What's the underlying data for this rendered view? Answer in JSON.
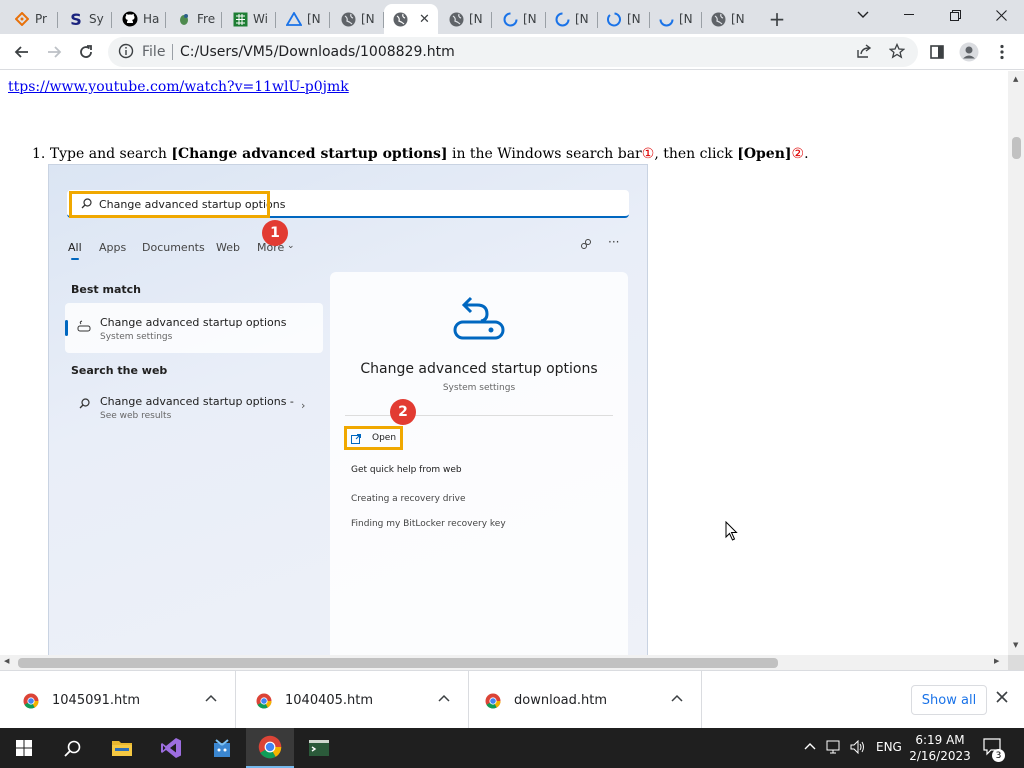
{
  "tabs": [
    {
      "label": "Pr",
      "icon": "diamond-icon",
      "color": "#e8710a"
    },
    {
      "label": "Sy",
      "icon": "s-logo-icon",
      "color": "#1a237e"
    },
    {
      "label": "Ha",
      "icon": "github-icon",
      "color": "#000000"
    },
    {
      "label": "Fre",
      "icon": "leaf-icon",
      "color": "#4e8a4e"
    },
    {
      "label": "Wi",
      "icon": "spreadsheet-icon",
      "color": "#1e7e34"
    },
    {
      "label": "[N",
      "icon": "triangle-icon",
      "color": "#1a73e8"
    },
    {
      "label": "[N",
      "icon": "globe-icon",
      "color": "#5f6368"
    },
    {
      "label": "",
      "icon": "globe-icon",
      "color": "#5f6368",
      "active": true
    },
    {
      "label": "[N",
      "icon": "globe-icon",
      "color": "#5f6368"
    },
    {
      "label": "[N",
      "icon": "loading-icon",
      "color": "#1a73e8"
    },
    {
      "label": "[N",
      "icon": "loading-icon",
      "color": "#1a73e8"
    },
    {
      "label": "[N",
      "icon": "loading-icon",
      "color": "#1a73e8"
    },
    {
      "label": "[N",
      "icon": "loading-icon",
      "color": "#1a73e8"
    },
    {
      "label": "[N",
      "icon": "globe-icon",
      "color": "#5f6368"
    }
  ],
  "toolbar": {
    "file_label": "File",
    "url": "C:/Users/VM5/Downloads/1008829.htm"
  },
  "page": {
    "link_text": "ttps://www.youtube.com/watch?v=11wlU-p0jmk",
    "step": {
      "number": "1.",
      "text_a": "Type and search ",
      "bold_a": "[Change advanced startup options]",
      "text_b": " in the Windows search bar",
      "circ_1": "①",
      "text_c": ", then click ",
      "bold_b": "[Open]",
      "circ_2": "②",
      "text_d": "."
    },
    "screenshot": {
      "search_text": "Change advanced startup options",
      "filters": [
        "All",
        "Apps",
        "Documents",
        "Web",
        "More"
      ],
      "badge_1": "1",
      "badge_2": "2",
      "best_match_label": "Best match",
      "best_title": "Change advanced startup options",
      "best_sub": "System settings",
      "search_web_label": "Search the web",
      "web_title": "Change advanced startup options -",
      "web_sub": "See web results",
      "right_title": "Change advanced startup options",
      "right_sub": "System settings",
      "open_label": "Open",
      "quick_help": "Get quick help from web",
      "link_1": "Creating a recovery drive",
      "link_2": "Finding my BitLocker recovery key"
    }
  },
  "downloads": {
    "items": [
      "1045091.htm",
      "1040405.htm",
      "download.htm"
    ],
    "show_all": "Show all"
  },
  "taskbar": {
    "language": "ENG",
    "time": "6:19 AM",
    "date": "2/16/2023",
    "notification_count": "3"
  }
}
